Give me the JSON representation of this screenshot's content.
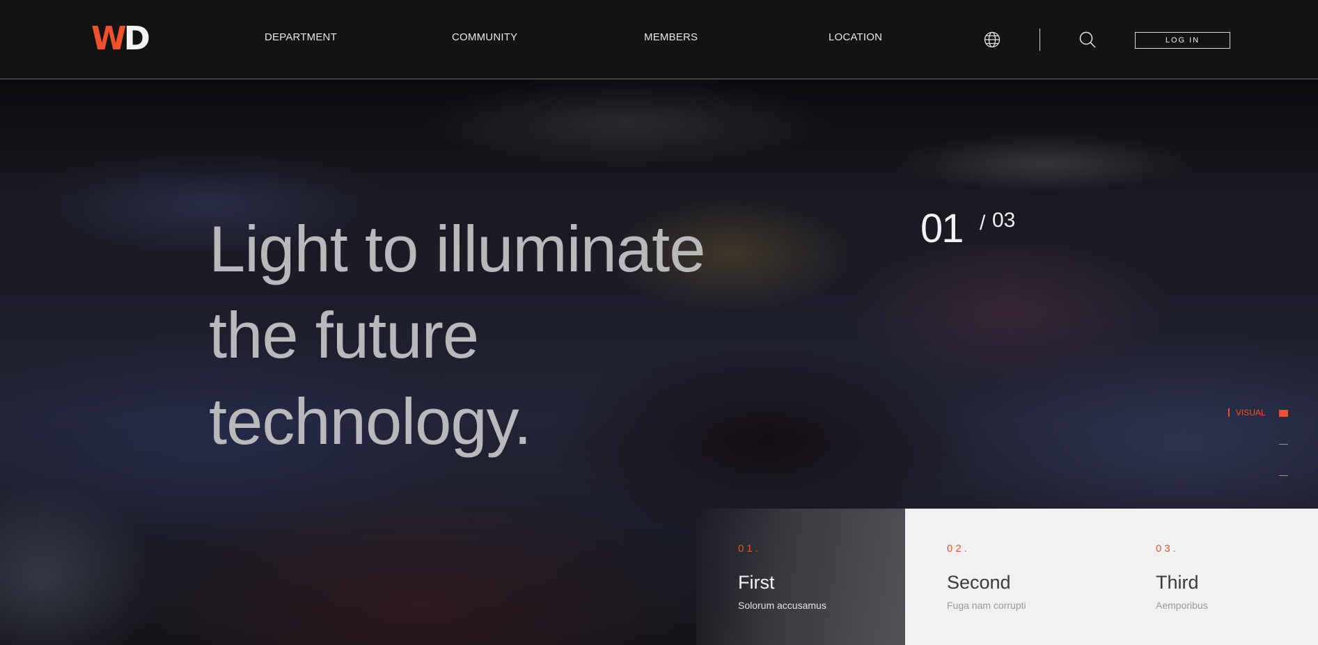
{
  "brand": {
    "logo_w": "W",
    "logo_d": "D",
    "accent": "#f0522d"
  },
  "nav": {
    "items": [
      "DEPARTMENT",
      "COMMUNITY",
      "MEMBERS",
      "LOCATION"
    ],
    "login_label": "LOG IN",
    "icons": [
      "globe-icon",
      "search-icon"
    ]
  },
  "hero": {
    "headline": [
      "Light to illuminate",
      "the future",
      "technology."
    ],
    "counter_current": "01",
    "counter_separator": "/",
    "counter_total": "03",
    "side_label": "VISUAL"
  },
  "cards": [
    {
      "num": "01.",
      "title": "First",
      "sub": "Solorum accusamus"
    },
    {
      "num": "02.",
      "title": "Second",
      "sub": "Fuga nam corrupti"
    },
    {
      "num": "03.",
      "title": "Third",
      "sub": "Aemporibus"
    }
  ]
}
